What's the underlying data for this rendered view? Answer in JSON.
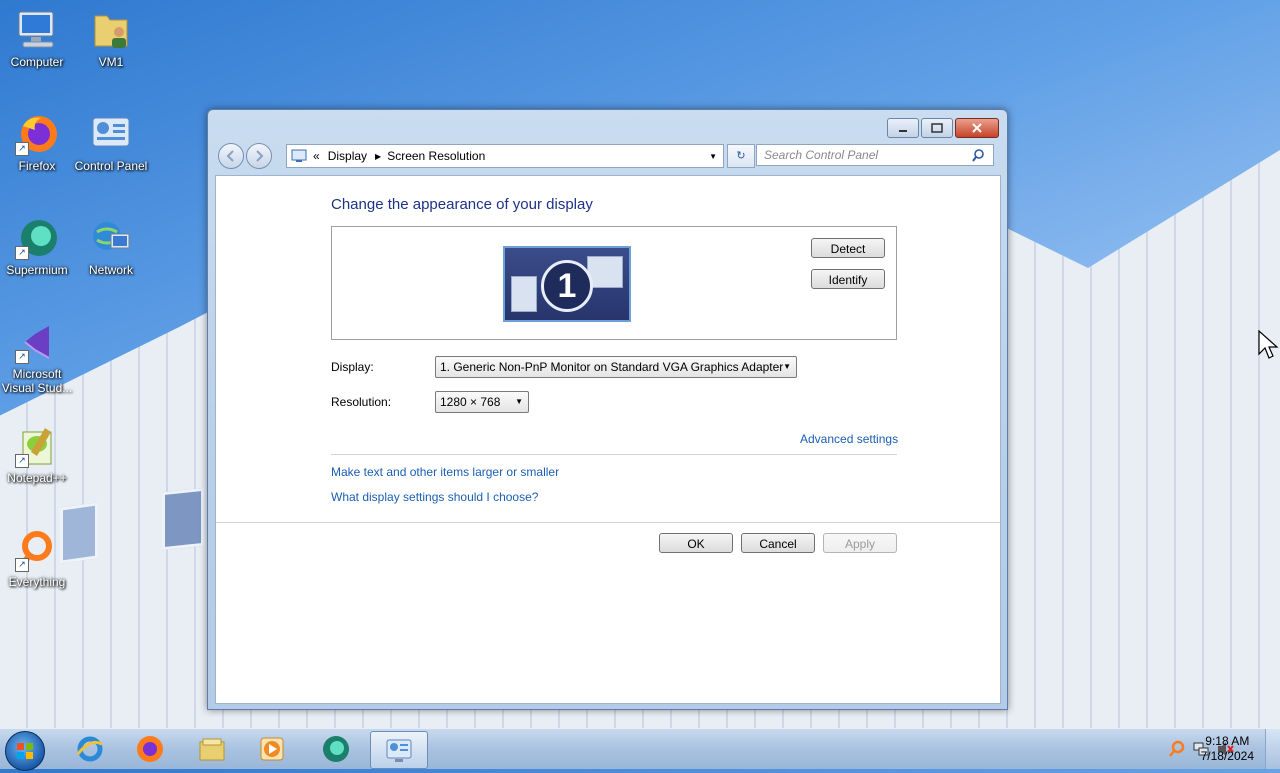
{
  "desktop": {
    "icons": [
      {
        "label": "Computer"
      },
      {
        "label": "VM1"
      },
      {
        "label": "Firefox"
      },
      {
        "label": "Control Panel"
      },
      {
        "label": "Supermium"
      },
      {
        "label": "Network"
      },
      {
        "label": "Microsoft Visual Stud..."
      },
      {
        "label": "Notepad++"
      },
      {
        "label": "Everything"
      }
    ]
  },
  "window": {
    "breadcrumb": {
      "root_glyph": "«",
      "item1": "Display",
      "item2": "Screen Resolution"
    },
    "search_placeholder": "Search Control Panel",
    "heading": "Change the appearance of your display",
    "monitor_number": "1",
    "detect_label": "Detect",
    "identify_label": "Identify",
    "display_label": "Display:",
    "display_value": "1. Generic Non-PnP Monitor on Standard VGA Graphics Adapter",
    "resolution_label": "Resolution:",
    "resolution_value": "1280 × 768",
    "advanced_link": "Advanced settings",
    "link_text_size": "Make text and other items larger or smaller",
    "link_choose": "What display settings should I choose?",
    "ok_label": "OK",
    "cancel_label": "Cancel",
    "apply_label": "Apply"
  },
  "taskbar": {
    "apps": [
      "internet-explorer-icon",
      "firefox-icon",
      "file-explorer-icon",
      "media-player-icon",
      "supermium-icon",
      "control-panel-icon"
    ],
    "clock_time": "9:18 AM",
    "clock_date": "7/18/2024"
  },
  "colors": {
    "heading": "#1e3287",
    "link": "#1a5fb4",
    "window_frame": "#b8cfe8"
  }
}
